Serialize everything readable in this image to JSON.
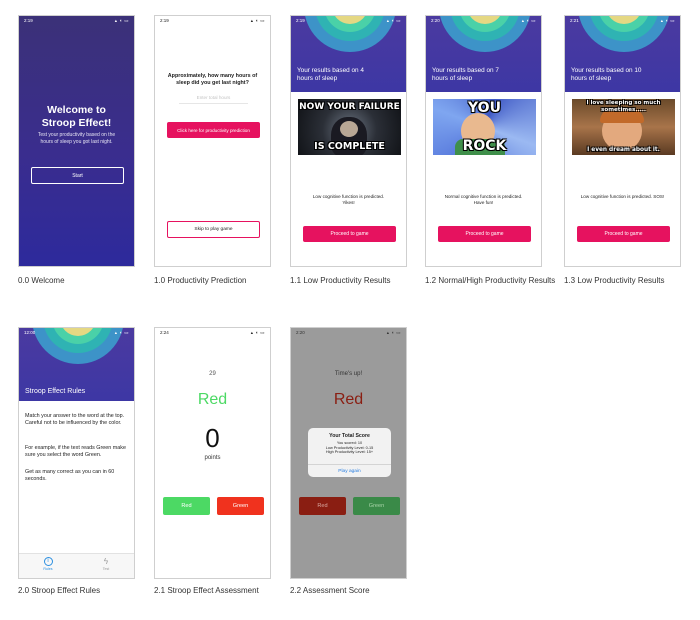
{
  "colors": {
    "brand_pink": "#e6125f",
    "indigo": "#3a2d8e",
    "green": "#4cd964",
    "red_btn": "#f0321e",
    "stroop_red": "#b22a1c"
  },
  "screens": {
    "welcome": {
      "time": "2:19",
      "title": "Welcome to Stroop Effect!",
      "subtitle": "Test your productivity based on the hours of sleep you got last night.",
      "start_label": "Start",
      "caption": "0.0 Welcome"
    },
    "prediction": {
      "time": "2:19",
      "question": "Approximately, how many hours of sleep did you get last night?",
      "input_placeholder": "Enter total hours",
      "predict_label": "Click here for productivity prediction",
      "skip_label": "Skip to play game",
      "caption": "1.0 Productivity Prediction"
    },
    "result_low_4": {
      "time": "2:19",
      "heading": "Your results based on 4 hours of sleep",
      "meme_top": "NOW YOUR FAILURE",
      "meme_bottom": "IS COMPLETE",
      "message": "Low cognitive function is predicted. Yikes!",
      "proceed_label": "Proceed to game",
      "caption": "1.1 Low Productivity Results"
    },
    "result_normal_7": {
      "time": "2:20",
      "heading": "Your results based on 7 hours of sleep",
      "meme_top": "YOU",
      "meme_bottom": "ROCK",
      "message": "Normal cognitive function is predicted. Have fun!",
      "proceed_label": "Proceed to game",
      "caption": "1.2 Normal/High Productivity Results"
    },
    "result_low_10": {
      "time": "2:21",
      "heading": "Your results based on 10 hours of sleep",
      "meme_top": "I love sleeping so much sometimes.....",
      "meme_bottom": "I even dream about it.",
      "message": "Low cognitive function is predicted. SOS!",
      "proceed_label": "Proceed to game",
      "caption": "1.3 Low Productivity Results"
    },
    "rules": {
      "time": "12:00",
      "title": "Stroop Effect Rules",
      "p1": "Match your answer to the word at the top. Careful not to be influenced by the color.",
      "p2": "For example, if the text reads Green make sure you select the word Green.",
      "p3": "Get as many correct as you can in 60 seconds.",
      "tab_rules": "Rules",
      "tab_test": "Test",
      "caption": "2.0 Stroop Effect Rules"
    },
    "assessment": {
      "time": "2:24",
      "timer": "29",
      "word": "Red",
      "score": "0",
      "points_label": "points",
      "btn_red": "Red",
      "btn_green": "Green",
      "caption": "2.1 Stroop Effect Assessment"
    },
    "score": {
      "time": "2:20",
      "times_up": "Time's up!",
      "word": "Red",
      "alert_title": "Your Total Score",
      "line1": "You scored: 10",
      "line2": "Low Productivity Level: 0-15",
      "line3": "High Productivity Level: 15+",
      "play_again": "Play again",
      "btn_red": "Red",
      "btn_green": "Green",
      "caption": "2.2 Assessment Score"
    }
  }
}
